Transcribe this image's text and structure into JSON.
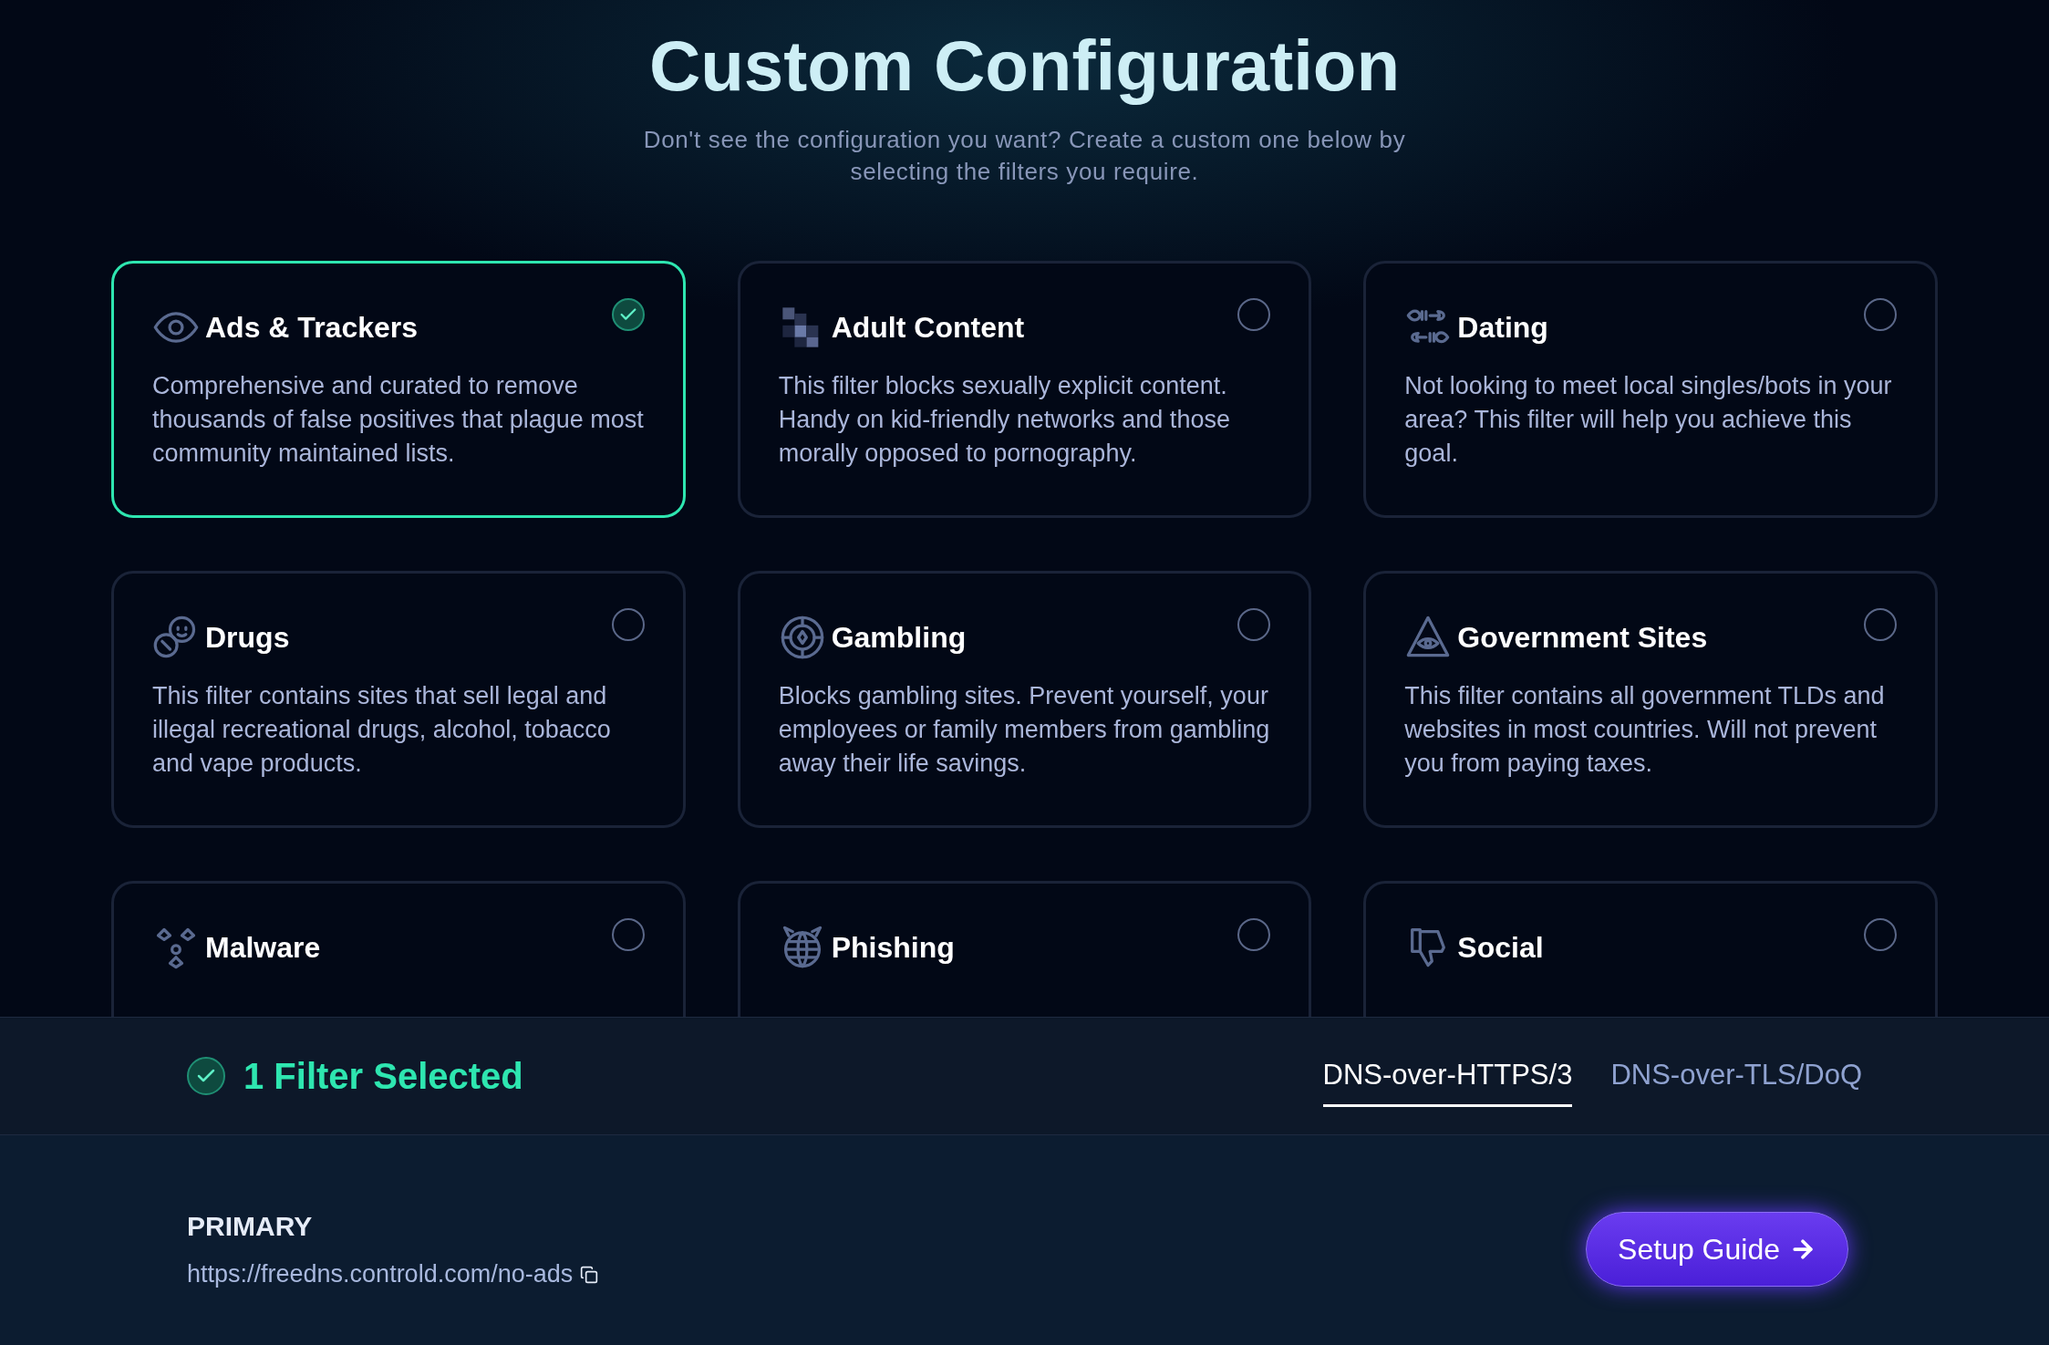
{
  "header": {
    "title": "Custom Configuration",
    "subtitle": "Don't see the configuration you want? Create a custom one below by selecting the filters you require."
  },
  "filters": [
    {
      "kind": "eye",
      "title": "Ads & Trackers",
      "description": "Comprehensive and curated to remove thousands of false positives that plague most community maintained lists.",
      "selected": true
    },
    {
      "kind": "pixels",
      "title": "Adult Content",
      "description": "This filter blocks sexually explicit content. Handy on kid-friendly networks and those morally opposed to pornography.",
      "selected": false
    },
    {
      "kind": "fish",
      "title": "Dating",
      "description": "Not looking to meet local singles/bots in your area? This filter will help you achieve this goal.",
      "selected": false
    },
    {
      "kind": "pills",
      "title": "Drugs",
      "description": "This filter contains sites that sell legal and illegal recreational drugs, alcohol, tobacco and vape products.",
      "selected": false
    },
    {
      "kind": "chip",
      "title": "Gambling",
      "description": "Blocks gambling sites. Prevent yourself, your employees or family members from gambling away their life savings.",
      "selected": false
    },
    {
      "kind": "pyramid",
      "title": "Government Sites",
      "description": "This filter contains all government TLDs and websites in most countries. Will not prevent you from paying taxes.",
      "selected": false
    },
    {
      "kind": "hazard",
      "title": "Malware",
      "selected": false
    },
    {
      "kind": "globe",
      "title": "Phishing",
      "selected": false
    },
    {
      "kind": "thumb",
      "title": "Social",
      "selected": false
    }
  ],
  "selection_bar": {
    "count_label": "1 Filter Selected",
    "tabs": [
      {
        "label": "DNS-over-HTTPS/3",
        "selected": true
      },
      {
        "label": "DNS-over-TLS/DoQ",
        "selected": false
      }
    ]
  },
  "endpoint": {
    "label": "PRIMARY",
    "url": "https://freedns.controld.com/no-ads",
    "button": "Setup Guide"
  }
}
